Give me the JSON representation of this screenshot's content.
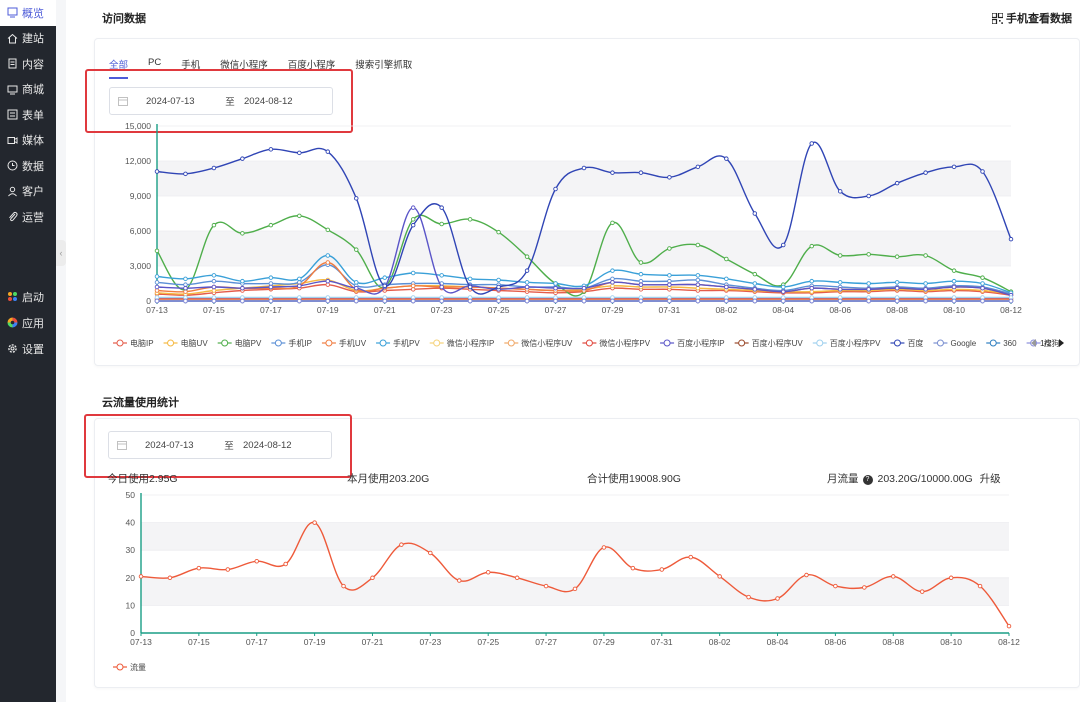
{
  "sidebar": {
    "items": [
      {
        "label": "概览",
        "icon": "overview-icon",
        "active": true
      },
      {
        "label": "建站",
        "icon": "home-icon"
      },
      {
        "label": "内容",
        "icon": "document-icon"
      },
      {
        "label": "商城",
        "icon": "shop-icon"
      },
      {
        "label": "表单",
        "icon": "form-icon"
      },
      {
        "label": "媒体",
        "icon": "video-icon"
      },
      {
        "label": "数据",
        "icon": "clock-icon"
      },
      {
        "label": "客户",
        "icon": "user-icon"
      },
      {
        "label": "运营",
        "icon": "paperclip-icon"
      }
    ],
    "apps": [
      {
        "label": "启动",
        "icon": "launch-icon"
      },
      {
        "label": "应用",
        "icon": "apps-icon"
      },
      {
        "label": "设置",
        "icon": "settings-gear-icon"
      }
    ]
  },
  "visit": {
    "title": "访问数据",
    "mobile_link": "手机查看数据",
    "tabs": [
      "全部",
      "PC",
      "手机",
      "微信小程序",
      "百度小程序",
      "搜索引擎抓取"
    ],
    "active_tab": 0,
    "date_start": "2024-07-13",
    "date_sep": "至",
    "date_end": "2024-08-12",
    "legend_page": "1/2"
  },
  "cloud": {
    "title": "云流量使用统计",
    "date_start": "2024-07-13",
    "date_sep": "至",
    "date_end": "2024-08-12",
    "today_usage": "今日使用2.95G",
    "month_usage": "本月使用203.20G",
    "total_usage": "合计使用19008.90G",
    "monthly_label": "月流量",
    "monthly_value": "203.20G/10000.00G",
    "upgrade": "升级"
  },
  "chart_data": [
    {
      "type": "line",
      "x": [
        "07-13",
        "07-14",
        "07-15",
        "07-16",
        "07-17",
        "07-18",
        "07-19",
        "07-20",
        "07-21",
        "07-22",
        "07-23",
        "07-24",
        "07-25",
        "07-26",
        "07-27",
        "07-28",
        "07-29",
        "07-30",
        "07-31",
        "08-01",
        "08-02",
        "08-03",
        "08-04",
        "08-05",
        "08-06",
        "08-07",
        "08-08",
        "08-09",
        "08-10",
        "08-11",
        "08-12"
      ],
      "x_tick_labels": [
        "07-13",
        "07-15",
        "07-17",
        "07-19",
        "07-21",
        "07-23",
        "07-25",
        "07-27",
        "07-29",
        "07-31",
        "08-02",
        "08-04",
        "08-06",
        "08-08",
        "08-10",
        "08-12"
      ],
      "ylim": [
        0,
        15000
      ],
      "y_ticks": [
        "0",
        "3,000",
        "6,000",
        "9,000",
        "12,000",
        "15,000"
      ],
      "grid": true,
      "legend_position": "bottom",
      "series": [
        {
          "name": "电脑IP",
          "color": "#e45c4a",
          "values": [
            600,
            500,
            700,
            900,
            1000,
            1100,
            1400,
            800,
            900,
            1000,
            1100,
            1000,
            900,
            800,
            700,
            800,
            1100,
            1000,
            1000,
            900,
            900,
            800,
            700,
            700,
            800,
            800,
            900,
            800,
            900,
            800,
            500
          ]
        },
        {
          "name": "电脑UV",
          "color": "#f5b942",
          "values": [
            700,
            600,
            900,
            1100,
            1300,
            1500,
            1800,
            900,
            1100,
            1300,
            1300,
            1200,
            1100,
            1000,
            900,
            1000,
            1300,
            1200,
            1200,
            1100,
            1000,
            900,
            800,
            800,
            900,
            900,
            1000,
            900,
            1000,
            900,
            600
          ]
        },
        {
          "name": "电脑PV",
          "color": "#4fae4b",
          "values": [
            4300,
            1000,
            6500,
            5800,
            6500,
            7300,
            6100,
            4400,
            1200,
            7000,
            6600,
            7000,
            5900,
            3800,
            1500,
            800,
            6700,
            3300,
            4500,
            4800,
            3600,
            2300,
            1400,
            4700,
            3900,
            4000,
            3800,
            3900,
            2600,
            2000,
            800
          ]
        },
        {
          "name": "手机IP",
          "color": "#5b8fd6",
          "values": [
            1600,
            1400,
            1700,
            1500,
            1500,
            1600,
            3100,
            1300,
            1400,
            1500,
            1500,
            1400,
            1400,
            1200,
            1200,
            1100,
            1900,
            1700,
            1700,
            1800,
            1400,
            1100,
            900,
            1300,
            1200,
            1100,
            1200,
            1100,
            1300,
            1200,
            600
          ]
        },
        {
          "name": "手机UV",
          "color": "#f07c40",
          "values": [
            900,
            800,
            1200,
            1100,
            1100,
            1300,
            3300,
            1000,
            1100,
            1300,
            1200,
            1200,
            1100,
            1000,
            900,
            900,
            1600,
            1400,
            1400,
            1400,
            1200,
            1000,
            800,
            1100,
            1000,
            1000,
            1100,
            1000,
            1200,
            1100,
            500
          ]
        },
        {
          "name": "手机PV",
          "color": "#3aa0d8",
          "values": [
            2100,
            1900,
            2200,
            1700,
            2000,
            1900,
            3900,
            1600,
            2000,
            2400,
            2200,
            1900,
            1800,
            1600,
            1500,
            1300,
            2600,
            2300,
            2200,
            2200,
            1900,
            1500,
            1200,
            1700,
            1600,
            1500,
            1600,
            1500,
            1700,
            1500,
            700
          ]
        },
        {
          "name": "微信小程序IP",
          "color": "#f5d27a",
          "values": [
            100,
            100,
            100,
            100,
            100,
            100,
            100,
            100,
            100,
            100,
            100,
            100,
            100,
            100,
            100,
            100,
            100,
            100,
            100,
            100,
            100,
            100,
            100,
            100,
            100,
            100,
            100,
            100,
            100,
            100,
            100
          ]
        },
        {
          "name": "微信小程序UV",
          "color": "#f0a868",
          "values": [
            150,
            150,
            150,
            150,
            150,
            150,
            150,
            150,
            150,
            150,
            150,
            150,
            150,
            150,
            150,
            150,
            150,
            150,
            150,
            150,
            150,
            150,
            150,
            150,
            150,
            150,
            150,
            150,
            150,
            150,
            150
          ]
        },
        {
          "name": "微信小程序PV",
          "color": "#e0463c",
          "values": [
            200,
            200,
            200,
            200,
            200,
            200,
            200,
            200,
            200,
            200,
            200,
            200,
            200,
            200,
            200,
            200,
            200,
            200,
            200,
            200,
            200,
            200,
            200,
            200,
            200,
            200,
            200,
            200,
            200,
            200,
            200
          ]
        },
        {
          "name": "百度小程序IP",
          "color": "#5a55c8",
          "values": [
            1200,
            1100,
            1200,
            1100,
            1200,
            1300,
            1700,
            1100,
            1200,
            8000,
            1200,
            1300,
            1000,
            1200,
            1100,
            1100,
            1600,
            1400,
            1400,
            1400,
            1200,
            1000,
            800,
            1100,
            1000,
            1000,
            1100,
            1000,
            1200,
            1100,
            500
          ]
        },
        {
          "name": "百度小程序UV",
          "color": "#9a4a2c",
          "values": [
            0,
            0,
            0,
            0,
            0,
            0,
            0,
            0,
            0,
            0,
            0,
            0,
            0,
            0,
            0,
            0,
            0,
            0,
            0,
            0,
            0,
            0,
            0,
            0,
            0,
            0,
            0,
            0,
            0,
            0,
            0
          ]
        },
        {
          "name": "百度小程序PV",
          "color": "#9fd0ee",
          "values": [
            300,
            300,
            300,
            300,
            300,
            300,
            300,
            300,
            300,
            300,
            300,
            300,
            300,
            300,
            300,
            300,
            300,
            300,
            300,
            300,
            300,
            300,
            300,
            300,
            300,
            300,
            300,
            300,
            300,
            300,
            300
          ]
        },
        {
          "name": "百度",
          "color": "#3045b5",
          "values": [
            11100,
            10900,
            11400,
            12200,
            13000,
            12700,
            12800,
            8800,
            1300,
            6500,
            8000,
            1200,
            1200,
            2600,
            9600,
            11400,
            11000,
            11000,
            10600,
            11500,
            12200,
            7500,
            4800,
            13500,
            9400,
            9000,
            10100,
            11000,
            11500,
            11100,
            5300
          ]
        },
        {
          "name": "Google",
          "color": "#7a8fd0",
          "values": [
            0,
            0,
            0,
            0,
            0,
            0,
            0,
            0,
            0,
            0,
            0,
            0,
            0,
            0,
            0,
            0,
            0,
            0,
            0,
            0,
            0,
            0,
            0,
            0,
            0,
            0,
            0,
            0,
            0,
            0,
            0
          ]
        },
        {
          "name": "360",
          "color": "#2f7fc0",
          "values": [
            0,
            0,
            0,
            0,
            0,
            0,
            0,
            0,
            0,
            0,
            0,
            0,
            0,
            0,
            0,
            0,
            0,
            0,
            0,
            0,
            0,
            0,
            0,
            0,
            0,
            0,
            0,
            0,
            0,
            0,
            0
          ]
        },
        {
          "name": "搜狗",
          "color": "#8b8fdc",
          "values": [
            0,
            0,
            0,
            0,
            0,
            0,
            0,
            0,
            0,
            0,
            0,
            0,
            0,
            0,
            0,
            0,
            0,
            0,
            0,
            0,
            0,
            0,
            0,
            0,
            0,
            0,
            0,
            0,
            0,
            0,
            0
          ]
        }
      ]
    },
    {
      "type": "line",
      "x": [
        "07-13",
        "07-14",
        "07-15",
        "07-16",
        "07-17",
        "07-18",
        "07-19",
        "07-20",
        "07-21",
        "07-22",
        "07-23",
        "07-24",
        "07-25",
        "07-26",
        "07-27",
        "07-28",
        "07-29",
        "07-30",
        "07-31",
        "08-01",
        "08-02",
        "08-03",
        "08-04",
        "08-05",
        "08-06",
        "08-07",
        "08-08",
        "08-09",
        "08-10",
        "08-11",
        "08-12"
      ],
      "x_tick_labels": [
        "07-13",
        "07-15",
        "07-17",
        "07-19",
        "07-21",
        "07-23",
        "07-25",
        "07-27",
        "07-29",
        "07-31",
        "08-02",
        "08-04",
        "08-06",
        "08-08",
        "08-10",
        "08-12"
      ],
      "ylim": [
        0,
        50
      ],
      "y_ticks": [
        "0",
        "10",
        "20",
        "30",
        "40",
        "50"
      ],
      "grid": true,
      "legend_position": "bottom",
      "series": [
        {
          "name": "流量",
          "color": "#ee5a3a",
          "values": [
            20.5,
            20,
            23.5,
            23,
            26,
            25,
            40,
            17,
            20,
            32,
            29,
            19,
            22,
            20,
            17,
            16,
            31,
            23.5,
            23,
            27.5,
            20.5,
            13,
            12.5,
            21,
            17,
            16.5,
            20.5,
            15,
            20,
            17,
            2.5
          ]
        }
      ]
    }
  ]
}
